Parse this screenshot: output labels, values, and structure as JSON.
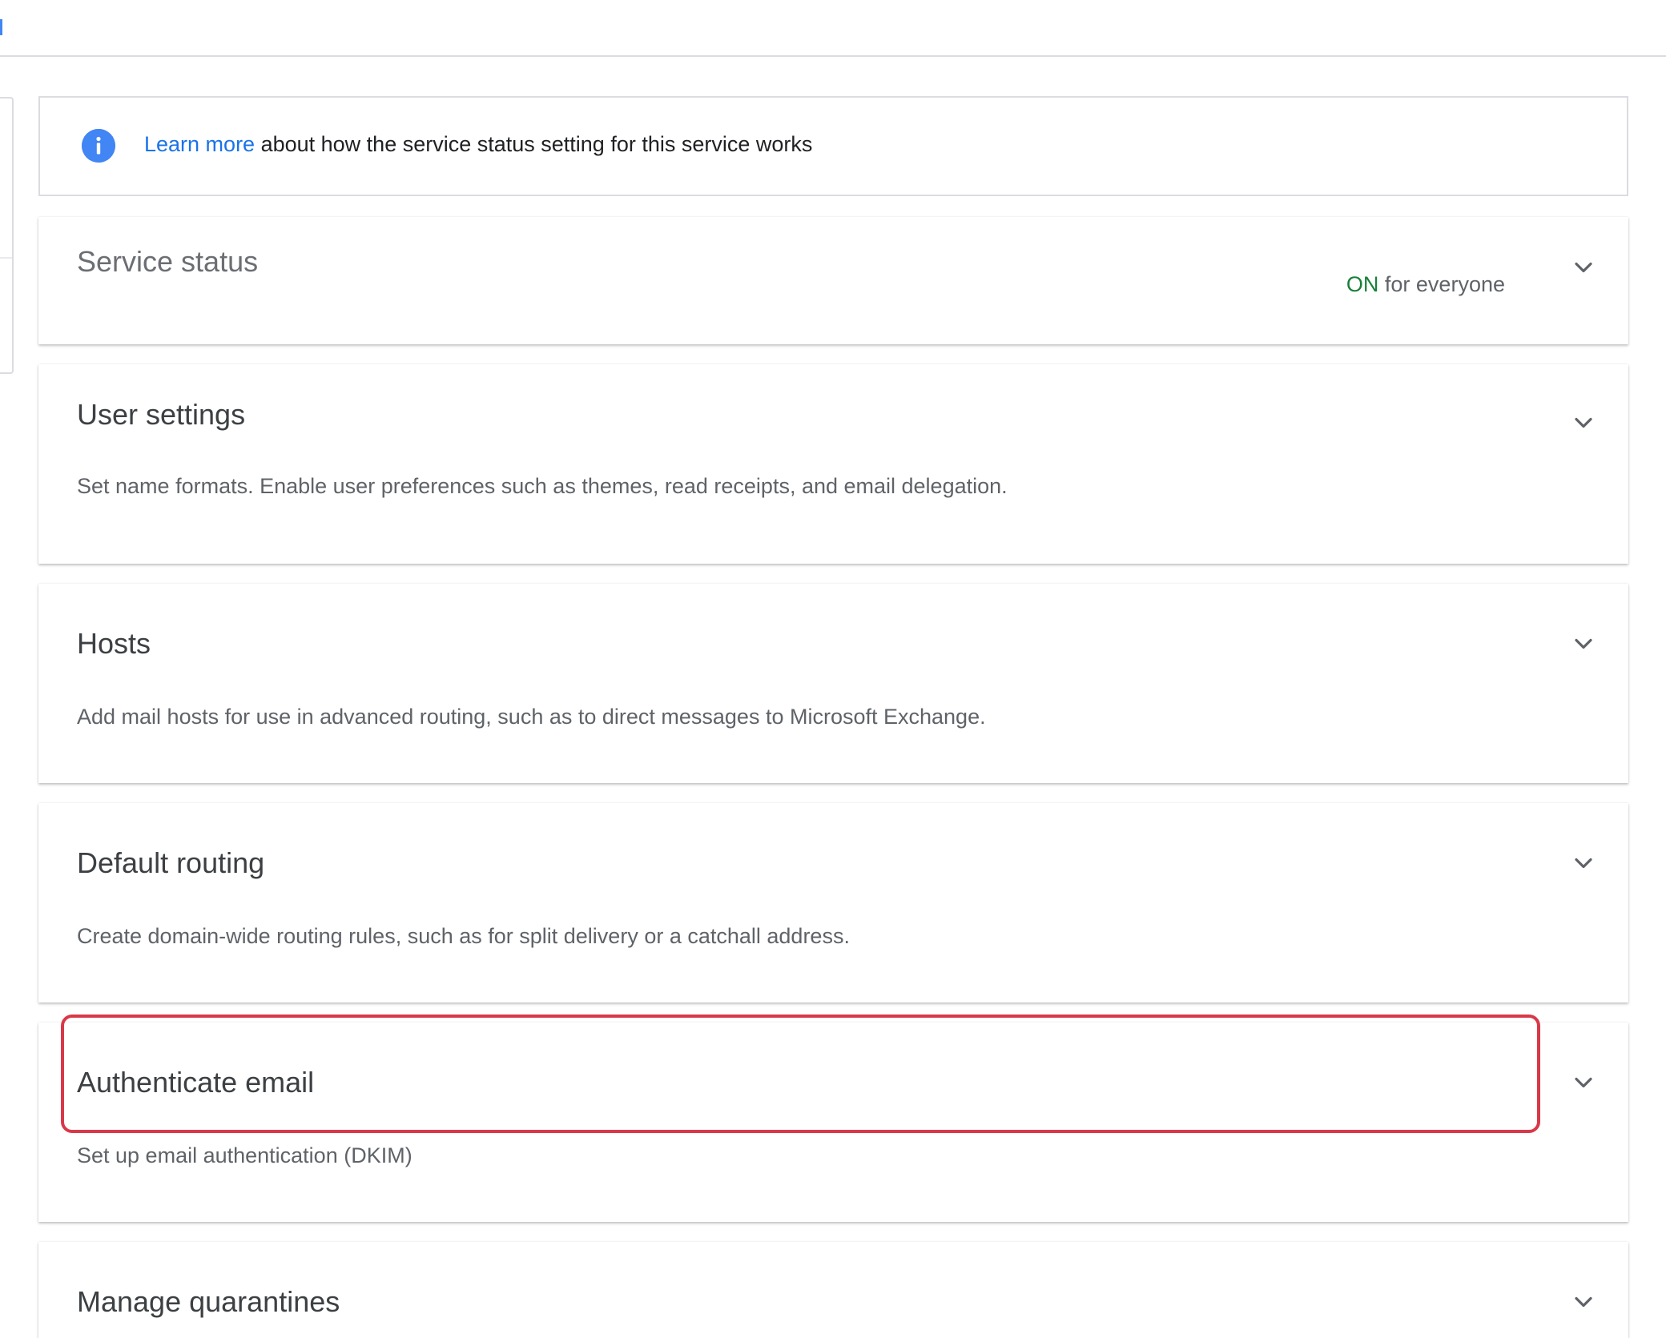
{
  "info": {
    "link_text": "Learn more",
    "text": " about how the service status setting for this service works",
    "icon": "info-icon"
  },
  "service_status": {
    "title": "Service status",
    "status_on": "ON",
    "status_rest": " for everyone"
  },
  "sections": [
    {
      "title": "User settings",
      "description": "Set name formats. Enable user preferences such as themes, read receipts, and email delegation."
    },
    {
      "title": "Hosts",
      "description": "Add mail hosts for use in advanced routing, such as to direct messages to Microsoft Exchange."
    },
    {
      "title": "Default routing",
      "description": "Create domain-wide routing rules, such as for split delivery or a catchall address."
    },
    {
      "title": "Authenticate email",
      "description": "Set up email authentication (DKIM)"
    },
    {
      "title": "Manage quarantines",
      "description": ""
    }
  ],
  "colors": {
    "link": "#1a73e8",
    "status_on": "#188038",
    "highlight": "#d93848",
    "info_icon": "#4285f4"
  }
}
